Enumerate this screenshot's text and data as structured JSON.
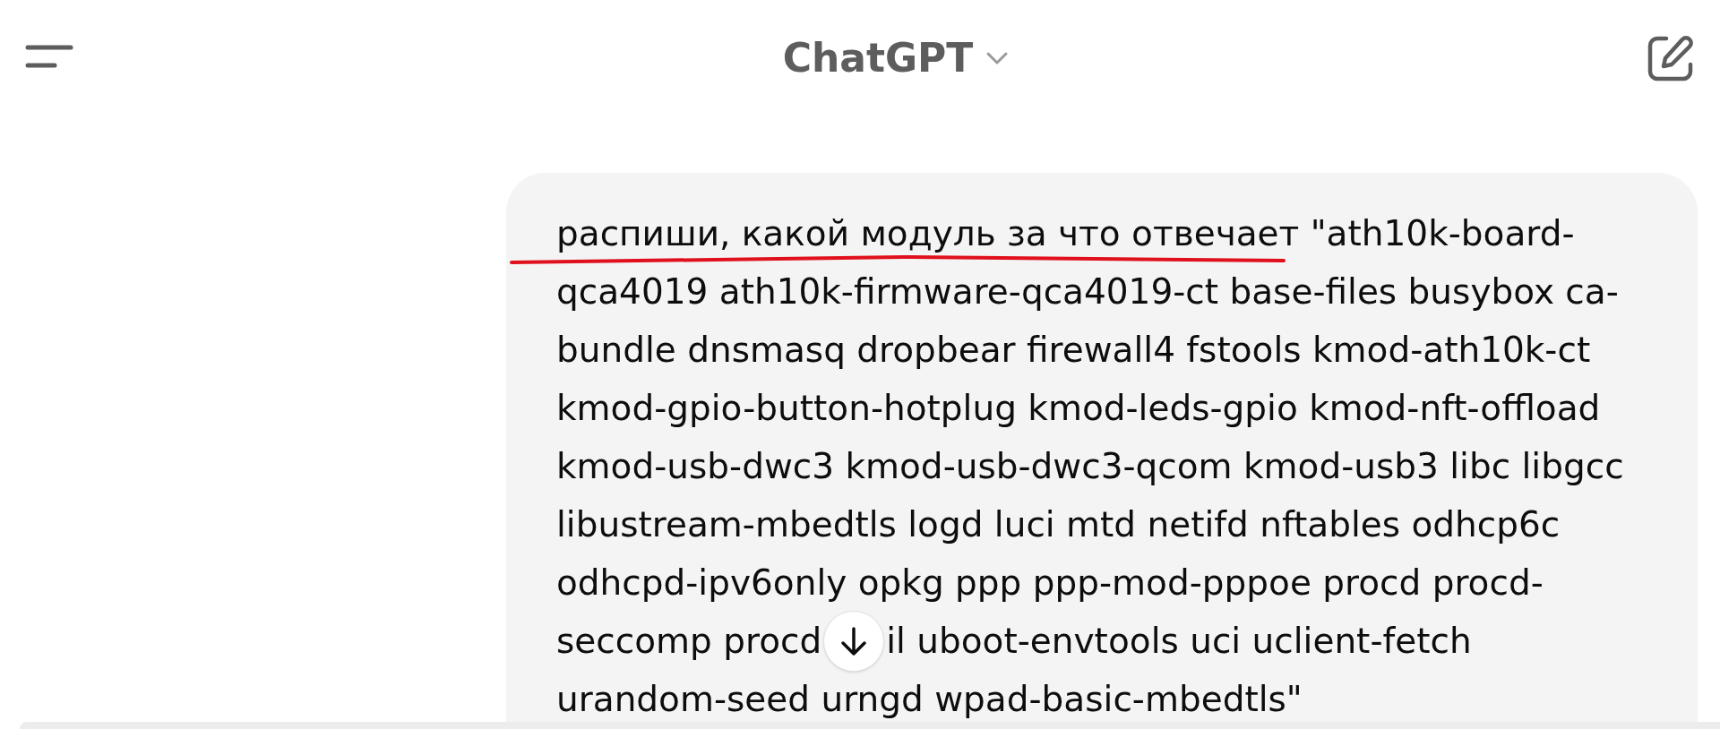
{
  "header": {
    "title": "ChatGPT"
  },
  "message": {
    "lines": [
      {
        "parts": [
          "распиши, какой модуль за что отвечает \"ath10k-board-"
        ]
      },
      {
        "parts": [
          "qca4019 ath10k-firmware-qca4019-ct base-files busybox ca-"
        ]
      },
      {
        "parts": [
          "bundle dnsmasq dropbear firewall4 fstools kmod-ath10k-ct"
        ]
      },
      {
        "parts": [
          "kmod-gpio-button-hotplug kmod-leds-gpio kmod-nft-offload"
        ]
      },
      {
        "parts": [
          "kmod-usb-dwc3 kmod-usb-dwc3-qcom kmod-usb3 libc libgcc"
        ]
      },
      {
        "parts": [
          "libustream-mbedtls logd luci mtd netifd nftables odhcp6c"
        ]
      },
      {
        "parts": [
          "odhcpd-ipv6only opkg ppp ppp-mod-pppoe procd procd-"
        ]
      },
      {
        "parts": [
          "seccomp procd",
          "il uboot-envtools uci uclient-fetch"
        ]
      },
      {
        "parts": [
          "urandom-seed urngd wpad-basic-mbedtls\""
        ]
      }
    ]
  }
}
